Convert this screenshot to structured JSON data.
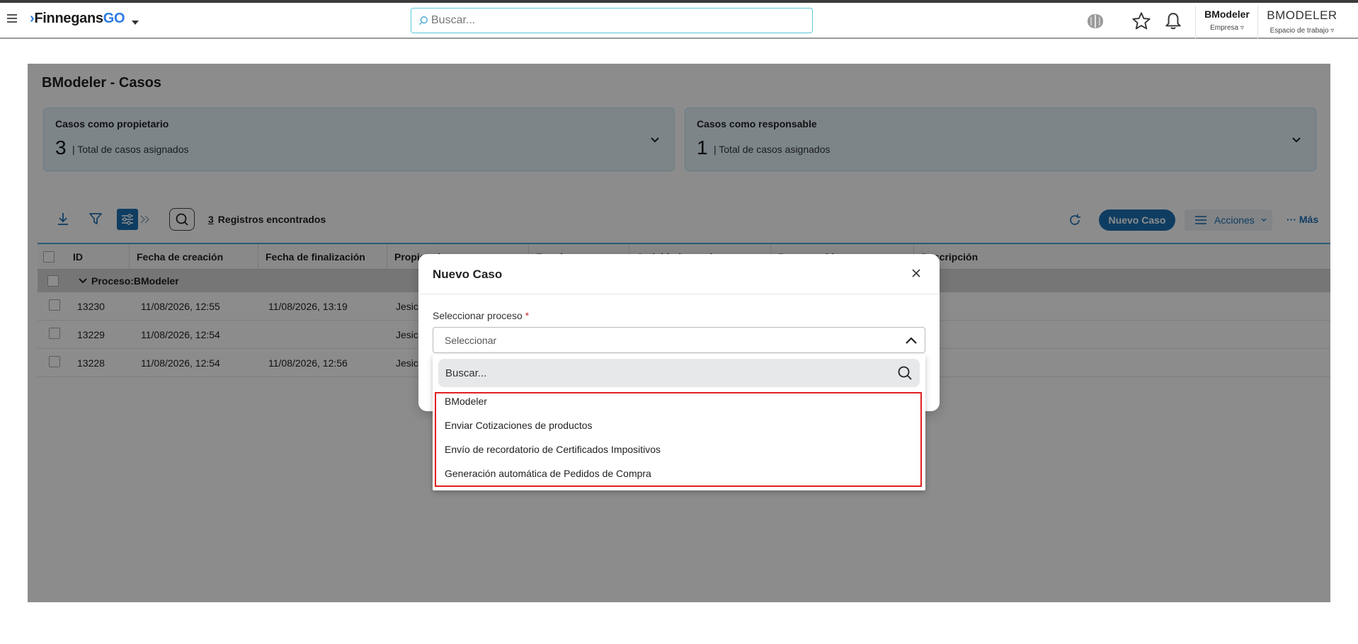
{
  "header": {
    "logo_main": "Finnegans",
    "logo_suffix": "GO",
    "search_placeholder": "Buscar...",
    "company_name": "BModeler",
    "company_label": "Empresa ▿",
    "workspace_name": "BMODELER",
    "workspace_label": "Espacio de trabajo ▿"
  },
  "page": {
    "title": "BModeler - Casos",
    "cards": [
      {
        "label": "Casos como propietario",
        "count": "3",
        "desc": "| Total de casos asignados"
      },
      {
        "label": "Casos como responsable",
        "count": "1",
        "desc": "| Total de casos asignados"
      }
    ]
  },
  "toolbar": {
    "count": "3",
    "count_label": "Registros encontrados",
    "new_case": "Nuevo Caso",
    "actions": "Acciones",
    "more": "··· Más"
  },
  "grid": {
    "columns": [
      "ID",
      "Fecha de creación",
      "Fecha de finalización",
      "Propietario",
      "Estado",
      "Actividad actual",
      "Responsable",
      "Descripción"
    ],
    "group": "Proceso:BModeler",
    "rows": [
      {
        "id": "13230",
        "created": "11/08/2026, 12:55",
        "finished": "11/08/2026, 13:19",
        "owner": "Jesic"
      },
      {
        "id": "13229",
        "created": "11/08/2026, 12:54",
        "finished": "",
        "owner": "Jesic"
      },
      {
        "id": "13228",
        "created": "11/08/2026, 12:54",
        "finished": "11/08/2026, 12:56",
        "owner": "Jesic"
      }
    ]
  },
  "modal": {
    "title": "Nuevo Caso",
    "field_label": "Seleccionar proceso",
    "required_mark": "*",
    "select_placeholder": "Seleccionar",
    "dropdown_search_placeholder": "Buscar...",
    "options": [
      "BModeler",
      "Enviar Cotizaciones de productos",
      "Envío de recordatorio de Certificados Impositivos",
      "Generación automática de Pedidos de Compra"
    ]
  },
  "colors": {
    "primary": "#1c6fb2",
    "card_bg": "#e4f2fa",
    "highlight_border": "#e02020"
  }
}
